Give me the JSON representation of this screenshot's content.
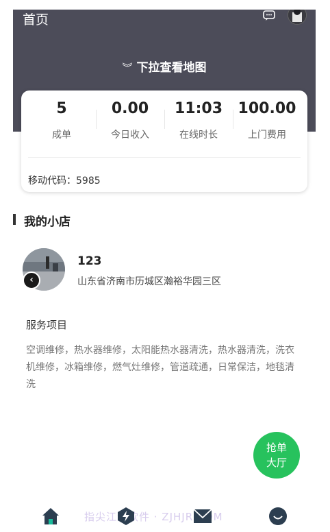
{
  "header": {
    "title": "首页",
    "pull_hint": "下拉查看地图"
  },
  "stats": [
    {
      "value": "5",
      "label": "成单"
    },
    {
      "value": "0.00",
      "label": "今日收入"
    },
    {
      "value": "11:03",
      "label": "在线时长"
    },
    {
      "value": "100.00",
      "label": "上门费用"
    }
  ],
  "mobile_code": "移动代码：5985",
  "shop": {
    "section_title": "我的小店",
    "name": "123",
    "address": "山东省济南市历城区瀚裕华园三区",
    "services_title": "服务项目",
    "services": "空调维修，热水器维修，太阳能热水器清洗，热水器清洗，洗衣机维修，冰箱维修，燃气灶维修，管道疏通，日常保洁，地毯清洗"
  },
  "fab": {
    "line1": "抢单",
    "line2": "大厅"
  },
  "watermark": "指尖江湖软件 · ZJHJR.COM",
  "colors": {
    "header_bg": "#4c4c59",
    "accent_green": "#27c25d"
  },
  "icons": {
    "header": [
      "chat-icon",
      "avatar"
    ],
    "tabbar": [
      "home-icon",
      "lightning-icon",
      "message-icon",
      "profile-icon"
    ]
  }
}
